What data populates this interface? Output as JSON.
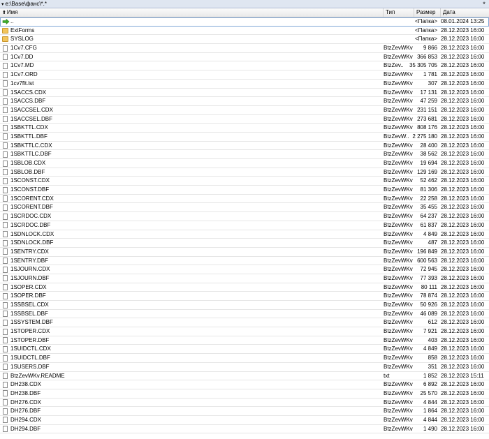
{
  "pathbar": {
    "path": "e:\\Base\\фанс\\*.*",
    "menu_glyph": "▾",
    "star_glyph": "*"
  },
  "columns": {
    "name": "Имя",
    "type": "Тип",
    "size": "Размер",
    "date": "Дата",
    "sort_glyph": "⬆"
  },
  "files": [
    {
      "name": "..",
      "type": "",
      "size": "<Папка>",
      "date": "08.01.2024 13:25",
      "icon": "up-arrow-icon",
      "selected": true
    },
    {
      "name": "ExtForms",
      "type": "",
      "size": "<Папка>",
      "date": "28.12.2023 16:00",
      "icon": "folder-icon"
    },
    {
      "name": "SYSLOG",
      "type": "",
      "size": "<Папка>",
      "date": "28.12.2023 16:00",
      "icon": "folder-icon"
    },
    {
      "name": "1Cv7.CFG",
      "type": "BtzZevWKv",
      "size": "9 866",
      "date": "28.12.2023 16:00",
      "icon": "file-icon"
    },
    {
      "name": "1Cv7.DD",
      "type": "BtzZevWKv",
      "size": "366 853",
      "date": "28.12.2023 16:00",
      "icon": "file-icon"
    },
    {
      "name": "1Cv7.MD",
      "type": "BtzZev..",
      "size": "35 305 705",
      "date": "28.12.2023 16:00",
      "icon": "file-icon"
    },
    {
      "name": "1Cv7.ORD",
      "type": "BtzZevWKv",
      "size": "1 781",
      "date": "28.12.2023 16:00",
      "icon": "file-icon"
    },
    {
      "name": "1cv7flt.lst",
      "type": "BtzZevWKv",
      "size": "307",
      "date": "28.12.2023 16:00",
      "icon": "file-icon"
    },
    {
      "name": "1SACCS.CDX",
      "type": "BtzZevWKv",
      "size": "17 131",
      "date": "28.12.2023 16:00",
      "icon": "file-icon"
    },
    {
      "name": "1SACCS.DBF",
      "type": "BtzZevWKv",
      "size": "47 259",
      "date": "28.12.2023 16:00",
      "icon": "file-icon"
    },
    {
      "name": "1SACCSEL.CDX",
      "type": "BtzZevWKv",
      "size": "231 151",
      "date": "28.12.2023 16:00",
      "icon": "file-icon"
    },
    {
      "name": "1SACCSEL.DBF",
      "type": "BtzZevWKv",
      "size": "273 681",
      "date": "28.12.2023 16:00",
      "icon": "file-icon"
    },
    {
      "name": "1SBKTTL.CDX",
      "type": "BtzZevWKv",
      "size": "808 176",
      "date": "28.12.2023 16:00",
      "icon": "file-icon"
    },
    {
      "name": "1SBKTTL.DBF",
      "type": "BtzZevW..",
      "size": "2 275 180",
      "date": "28.12.2023 16:00",
      "icon": "file-icon"
    },
    {
      "name": "1SBKTTLC.CDX",
      "type": "BtzZevWKv",
      "size": "28 400",
      "date": "28.12.2023 16:00",
      "icon": "file-icon"
    },
    {
      "name": "1SBKTTLC.DBF",
      "type": "BtzZevWKv",
      "size": "38 562",
      "date": "28.12.2023 16:00",
      "icon": "file-icon"
    },
    {
      "name": "1SBLOB.CDX",
      "type": "BtzZevWKv",
      "size": "19 694",
      "date": "28.12.2023 16:00",
      "icon": "file-icon"
    },
    {
      "name": "1SBLOB.DBF",
      "type": "BtzZevWKv",
      "size": "129 169",
      "date": "28.12.2023 16:00",
      "icon": "file-icon"
    },
    {
      "name": "1SCONST.CDX",
      "type": "BtzZevWKv",
      "size": "52 462",
      "date": "28.12.2023 16:00",
      "icon": "file-icon"
    },
    {
      "name": "1SCONST.DBF",
      "type": "BtzZevWKv",
      "size": "81 306",
      "date": "28.12.2023 16:00",
      "icon": "file-icon"
    },
    {
      "name": "1SCORENT.CDX",
      "type": "BtzZevWKv",
      "size": "22 258",
      "date": "28.12.2023 16:00",
      "icon": "file-icon"
    },
    {
      "name": "1SCORENT.DBF",
      "type": "BtzZevWKv",
      "size": "35 455",
      "date": "28.12.2023 16:00",
      "icon": "file-icon"
    },
    {
      "name": "1SCRDOC.CDX",
      "type": "BtzZevWKv",
      "size": "64 237",
      "date": "28.12.2023 16:00",
      "icon": "file-icon"
    },
    {
      "name": "1SCRDOC.DBF",
      "type": "BtzZevWKv",
      "size": "61 837",
      "date": "28.12.2023 16:00",
      "icon": "file-icon"
    },
    {
      "name": "1SDNLOCK.CDX",
      "type": "BtzZevWKv",
      "size": "4 849",
      "date": "28.12.2023 16:00",
      "icon": "file-icon"
    },
    {
      "name": "1SDNLOCK.DBF",
      "type": "BtzZevWKv",
      "size": "487",
      "date": "28.12.2023 16:00",
      "icon": "file-icon"
    },
    {
      "name": "1SENTRY.CDX",
      "type": "BtzZevWKv",
      "size": "196 849",
      "date": "28.12.2023 16:00",
      "icon": "file-icon"
    },
    {
      "name": "1SENTRY.DBF",
      "type": "BtzZevWKv",
      "size": "600 563",
      "date": "28.12.2023 16:00",
      "icon": "file-icon"
    },
    {
      "name": "1SJOURN.CDX",
      "type": "BtzZevWKv",
      "size": "72 945",
      "date": "28.12.2023 16:00",
      "icon": "file-icon"
    },
    {
      "name": "1SJOURN.DBF",
      "type": "BtzZevWKv",
      "size": "77 393",
      "date": "28.12.2023 16:00",
      "icon": "file-icon"
    },
    {
      "name": "1SOPER.CDX",
      "type": "BtzZevWKv",
      "size": "80 111",
      "date": "28.12.2023 16:00",
      "icon": "file-icon"
    },
    {
      "name": "1SOPER.DBF",
      "type": "BtzZevWKv",
      "size": "78 874",
      "date": "28.12.2023 16:00",
      "icon": "file-icon"
    },
    {
      "name": "1SSBSEL.CDX",
      "type": "BtzZevWKv",
      "size": "50 926",
      "date": "28.12.2023 16:00",
      "icon": "file-icon"
    },
    {
      "name": "1SSBSEL.DBF",
      "type": "BtzZevWKv",
      "size": "46 089",
      "date": "28.12.2023 16:00",
      "icon": "file-icon"
    },
    {
      "name": "1SSYSTEM.DBF",
      "type": "BtzZevWKv",
      "size": "612",
      "date": "28.12.2023 16:00",
      "icon": "file-icon"
    },
    {
      "name": "1STOPER.CDX",
      "type": "BtzZevWKv",
      "size": "7 921",
      "date": "28.12.2023 16:00",
      "icon": "file-icon"
    },
    {
      "name": "1STOPER.DBF",
      "type": "BtzZevWKv",
      "size": "403",
      "date": "28.12.2023 16:00",
      "icon": "file-icon"
    },
    {
      "name": "1SUIDCTL.CDX",
      "type": "BtzZevWKv",
      "size": "4 849",
      "date": "28.12.2023 16:00",
      "icon": "file-icon"
    },
    {
      "name": "1SUIDCTL.DBF",
      "type": "BtzZevWKv",
      "size": "858",
      "date": "28.12.2023 16:00",
      "icon": "file-icon"
    },
    {
      "name": "1SUSERS.DBF",
      "type": "BtzZevWKv",
      "size": "351",
      "date": "28.12.2023 16:00",
      "icon": "file-icon"
    },
    {
      "name": "BtzZevWKv.README",
      "type": "txt",
      "size": "1 852",
      "date": "28.12.2023 15:11",
      "icon": "file-icon"
    },
    {
      "name": "DH238.CDX",
      "type": "BtzZevWKv",
      "size": "6 892",
      "date": "28.12.2023 16:00",
      "icon": "file-icon"
    },
    {
      "name": "DH238.DBF",
      "type": "BtzZevWKv",
      "size": "25 570",
      "date": "28.12.2023 16:00",
      "icon": "file-icon"
    },
    {
      "name": "DH276.CDX",
      "type": "BtzZevWKv",
      "size": "4 844",
      "date": "28.12.2023 16:00",
      "icon": "file-icon"
    },
    {
      "name": "DH276.DBF",
      "type": "BtzZevWKv",
      "size": "1 864",
      "date": "28.12.2023 16:00",
      "icon": "file-icon"
    },
    {
      "name": "DH294.CDX",
      "type": "BtzZevWKv",
      "size": "4 844",
      "date": "28.12.2023 16:00",
      "icon": "file-icon"
    },
    {
      "name": "DH294.DBF",
      "type": "BtzZevWKv",
      "size": "1 490",
      "date": "28.12.2023 16:00",
      "icon": "file-icon"
    }
  ]
}
